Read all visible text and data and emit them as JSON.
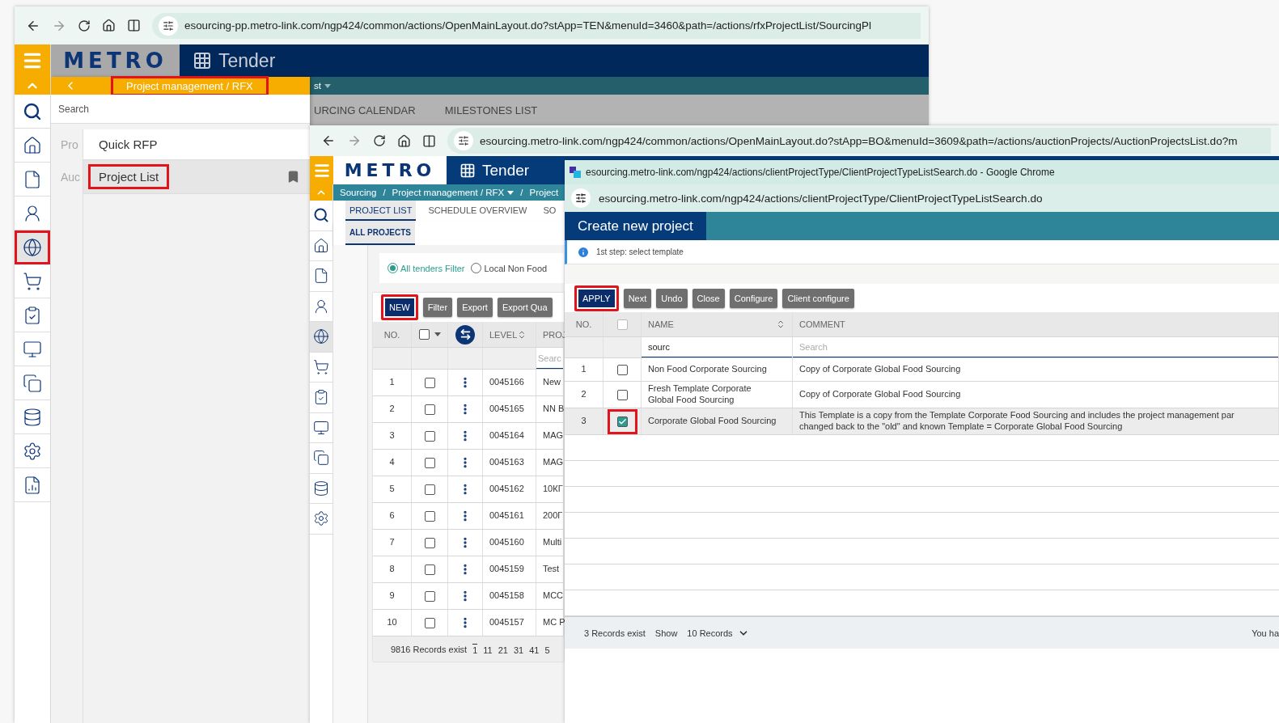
{
  "background_window": {
    "url": "esourcing-pp.metro-link.com/ngp424/common/actions/OpenMainLayout.do?stApp=TEN&menuId=3460&path=/actions/rfxProjectList/SourcingPl",
    "logo": "METRO",
    "app_title": "Tender",
    "breadcrumb_fragment": "st",
    "tabs": [
      "URCING CALENDAR",
      "MILESTONES LIST"
    ],
    "rail": [
      {
        "kind": "search",
        "selected": false,
        "highlighted": false
      },
      {
        "kind": "home",
        "selected": false,
        "highlighted": false
      },
      {
        "kind": "document",
        "selected": false,
        "highlighted": false
      },
      {
        "kind": "user",
        "selected": false,
        "highlighted": false
      },
      {
        "kind": "globe",
        "selected": true,
        "highlighted": true
      },
      {
        "kind": "cart",
        "selected": false,
        "highlighted": false
      },
      {
        "kind": "clipboard",
        "selected": false,
        "highlighted": false
      },
      {
        "kind": "monitor",
        "selected": false,
        "highlighted": false
      },
      {
        "kind": "copy",
        "selected": false,
        "highlighted": false
      },
      {
        "kind": "user-database",
        "selected": false,
        "highlighted": false
      },
      {
        "kind": "settings",
        "selected": false,
        "highlighted": false
      },
      {
        "kind": "report",
        "selected": false,
        "highlighted": false
      }
    ],
    "menu": {
      "title": "Project management / RFX",
      "highlighted": true,
      "search_placeholder": "Search",
      "categories": [
        "Pro",
        "Auc"
      ],
      "items": [
        {
          "label": "Quick RFP",
          "selected": false,
          "highlighted": false,
          "bookmarked": false
        },
        {
          "label": "Project List",
          "selected": true,
          "highlighted": true,
          "bookmarked": true
        }
      ]
    }
  },
  "middle_window": {
    "url": "esourcing.metro-link.com/ngp424/common/actions/OpenMainLayout.do?stApp=BO&menuId=3609&path=/actions/auctionProjects/AuctionProjectsList.do?m",
    "logo": "METRO",
    "app_title": "Tender",
    "breadcrumb": [
      {
        "kind": "link",
        "label": "Sourcing"
      },
      {
        "kind": "separator",
        "label": "/"
      },
      {
        "kind": "menu",
        "label": "Project management / RFX"
      },
      {
        "kind": "separator",
        "label": "/"
      },
      {
        "kind": "link",
        "label": "Project"
      }
    ],
    "tabs": [
      {
        "label": "PROJECT LIST",
        "selected": true
      },
      {
        "label": "SCHEDULE OVERVIEW",
        "selected": false
      },
      {
        "label": "SO",
        "selected": false
      }
    ],
    "subtabs": [
      {
        "label": "ALL PROJECTS",
        "selected": true
      }
    ],
    "rail": [
      {
        "kind": "search",
        "selected": false
      },
      {
        "kind": "home",
        "selected": false
      },
      {
        "kind": "document",
        "selected": false
      },
      {
        "kind": "user",
        "selected": false
      },
      {
        "kind": "globe",
        "selected": true
      },
      {
        "kind": "cart",
        "selected": false
      },
      {
        "kind": "clipboard",
        "selected": false
      },
      {
        "kind": "monitor",
        "selected": false
      },
      {
        "kind": "copy",
        "selected": false
      },
      {
        "kind": "user-database",
        "selected": false
      },
      {
        "kind": "settings",
        "selected": false
      }
    ],
    "filters": [
      {
        "label": "All tenders Filter",
        "selected": true
      },
      {
        "label": "Local Non Food",
        "selected": false
      }
    ],
    "buttons": [
      {
        "label": "NEW",
        "kind": "primary",
        "highlighted": true
      },
      {
        "label": "Filter",
        "kind": "secondary",
        "highlighted": false
      },
      {
        "label": "Export",
        "kind": "secondary",
        "highlighted": false
      },
      {
        "label": "Export Qua",
        "kind": "secondary",
        "highlighted": false
      }
    ],
    "table": {
      "columns": [
        {
          "kind": "text",
          "label": "NO."
        },
        {
          "kind": "checkbox",
          "checked": false
        },
        {
          "kind": "expand"
        },
        {
          "kind": "sortable",
          "label": "LEVEL"
        },
        {
          "kind": "text",
          "label": "PROJ"
        }
      ],
      "filter_placeholder": "Searc",
      "rows": [
        {
          "no": "1",
          "checked": false,
          "level": "0045166",
          "project": "New"
        },
        {
          "no": "2",
          "checked": false,
          "level": "0045165",
          "project": "NN B"
        },
        {
          "no": "3",
          "checked": false,
          "level": "0045164",
          "project": "MAG"
        },
        {
          "no": "4",
          "checked": false,
          "level": "0045163",
          "project": "MAG"
        },
        {
          "no": "5",
          "checked": false,
          "level": "0045162",
          "project": "10КГ"
        },
        {
          "no": "6",
          "checked": false,
          "level": "0045161",
          "project": "200Г"
        },
        {
          "no": "7",
          "checked": false,
          "level": "0045160",
          "project": "Multi"
        },
        {
          "no": "8",
          "checked": false,
          "level": "0045159",
          "project": "Test"
        },
        {
          "no": "9",
          "checked": false,
          "level": "0045158",
          "project": "MCC"
        },
        {
          "no": "10",
          "checked": false,
          "level": "0045157",
          "project": "MC P"
        }
      ]
    },
    "pagination": {
      "summary": "9816 Records exist",
      "pages": [
        {
          "label": "1",
          "selected": true
        },
        {
          "label": "11",
          "selected": false
        },
        {
          "label": "21",
          "selected": false
        },
        {
          "label": "31",
          "selected": false
        },
        {
          "label": "41",
          "selected": false
        },
        {
          "label": "5",
          "selected": false
        }
      ]
    }
  },
  "dialog_window": {
    "title": "esourcing.metro-link.com/ngp424/actions/clientProjectType/ClientProjectTypeListSearch.do - Google Chrome",
    "url": "esourcing.metro-link.com/ngp424/actions/clientProjectType/ClientProjectTypeListSearch.do",
    "heading": "Create new project",
    "info": "1st step: select template",
    "buttons": [
      {
        "label": "APPLY",
        "kind": "primary",
        "highlighted": true
      },
      {
        "label": "Next",
        "kind": "secondary",
        "highlighted": false
      },
      {
        "label": "Undo",
        "kind": "secondary",
        "highlighted": false
      },
      {
        "label": "Close",
        "kind": "secondary",
        "highlighted": false
      },
      {
        "label": "Configure",
        "kind": "secondary",
        "highlighted": false
      },
      {
        "label": "Client configure",
        "kind": "secondary",
        "highlighted": false
      }
    ],
    "table": {
      "columns": [
        {
          "kind": "text",
          "label": "NO."
        },
        {
          "kind": "checkbox",
          "checked": false
        },
        {
          "kind": "sortable",
          "label": "NAME"
        },
        {
          "kind": "text",
          "label": "COMMENT"
        }
      ],
      "name_filter_value": "sourc",
      "comment_filter_placeholder": "Search",
      "rows": [
        {
          "no": "1",
          "checked": false,
          "highlighted": false,
          "selected": false,
          "name_lines": [
            "Non Food Corporate Sourcing"
          ],
          "comment_lines": [
            "Copy of Corporate Global Food Sourcing"
          ]
        },
        {
          "no": "2",
          "checked": false,
          "highlighted": false,
          "selected": false,
          "name_lines": [
            "Fresh Template Corporate",
            "Global Food Sourcing"
          ],
          "comment_lines": [
            "Copy of Corporate Global Food Sourcing"
          ]
        },
        {
          "no": "3",
          "checked": true,
          "highlighted": true,
          "selected": true,
          "name_lines": [
            "Corporate Global Food Sourcing"
          ],
          "comment_lines": [
            "This Template is a copy from the Template Corporate Food Sourcing and includes the project management par",
            "changed back to the \"old\" and known Template = Corporate Global Food Sourcing"
          ]
        }
      ]
    },
    "footer": {
      "summary": "3 Records exist",
      "show_label": "Show",
      "page_size": "10 Records",
      "note": "You ha"
    }
  }
}
